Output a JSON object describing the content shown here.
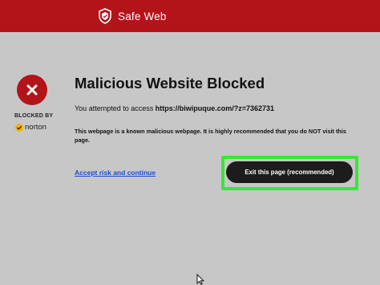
{
  "header": {
    "brand": "Safe Web",
    "icon": "shield-icon",
    "color": "#b3141a"
  },
  "sidebar": {
    "status_icon": "close-icon",
    "blocked_by": "BLOCKED BY",
    "norton_label": "norton",
    "norton_icon": "check-icon"
  },
  "main": {
    "title": "Malicious Website Blocked",
    "attempt_prefix": "You attempted to access",
    "url": "https://biwipuque.com/?z=7362731",
    "warning": "This webpage is a known malicious webpage. It is highly recommended that you do NOT visit this page.",
    "accept_link": "Accept risk and continue",
    "exit_button": "Exit this page (recommended)"
  },
  "colors": {
    "background": "#c7c7c7",
    "brand_red": "#b3141a",
    "highlight": "#39e639",
    "link": "#1a4fd6",
    "button": "#1c1c1c"
  }
}
